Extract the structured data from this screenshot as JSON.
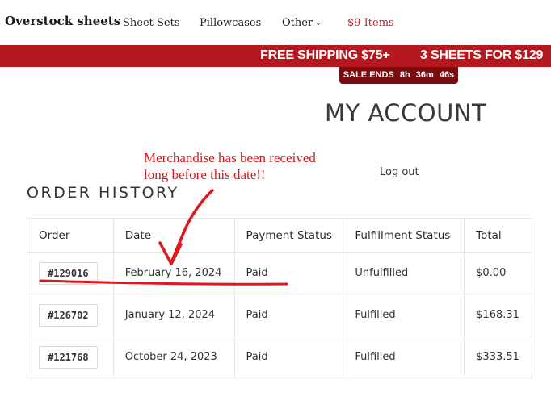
{
  "header": {
    "brand": "Overstock sheets",
    "nav": [
      {
        "label": "Sheet Sets"
      },
      {
        "label": "Pillowcases"
      },
      {
        "label": "Other"
      },
      {
        "label": "$9 Items"
      }
    ]
  },
  "banner": {
    "promo1": "FREE SHIPPING $75+",
    "promo2": "3 SHEETS FOR $129",
    "timer": {
      "label": "SALE ENDS",
      "hours": "8h",
      "minutes": "36m",
      "seconds": "46s"
    }
  },
  "page": {
    "title": "MY ACCOUNT",
    "logout": "Log out",
    "section_title": "ORDER HISTORY"
  },
  "annotation": {
    "line1": "Merchandise has been received",
    "line2": "long before this date!!"
  },
  "orders": {
    "columns": [
      "Order",
      "Date",
      "Payment Status",
      "Fulfillment Status",
      "Total"
    ],
    "rows": [
      {
        "order": "#129016",
        "date": "February 16, 2024",
        "payment": "Paid",
        "fulfillment": "Unfulfilled",
        "total": "$0.00"
      },
      {
        "order": "#126702",
        "date": "January 12, 2024",
        "payment": "Paid",
        "fulfillment": "Fulfilled",
        "total": "$168.31"
      },
      {
        "order": "#121768",
        "date": "October 24, 2023",
        "payment": "Paid",
        "fulfillment": "Fulfilled",
        "total": "$333.51"
      }
    ]
  },
  "colors": {
    "banner": "#b5181e",
    "timer": "#7a0c10",
    "annotation": "#d11a1a",
    "nav_highlight": "#c0212a"
  }
}
